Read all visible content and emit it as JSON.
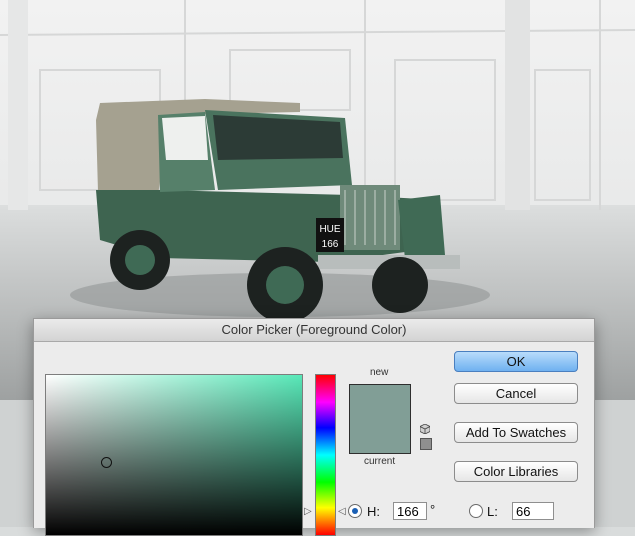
{
  "dialog": {
    "title": "Color Picker (Foreground Color)",
    "new_label": "new",
    "current_label": "current",
    "new_color": "#819e96",
    "current_color": "#819e96",
    "buttons": {
      "ok": "OK",
      "cancel": "Cancel",
      "add_to_swatches": "Add To Swatches",
      "color_libraries": "Color Libraries"
    },
    "fields": {
      "h": {
        "label": "H:",
        "value": "166",
        "unit": "°",
        "selected": true
      },
      "l": {
        "label": "L:",
        "value": "66",
        "selected": false
      }
    },
    "hue_arrows": {
      "left": "▷",
      "right": "◁"
    }
  },
  "colors": {
    "field_hue": "#58e8b8",
    "ok_button": "#6fb1f0"
  },
  "background": {
    "plate_line1": "HUE",
    "plate_line2": "166"
  }
}
